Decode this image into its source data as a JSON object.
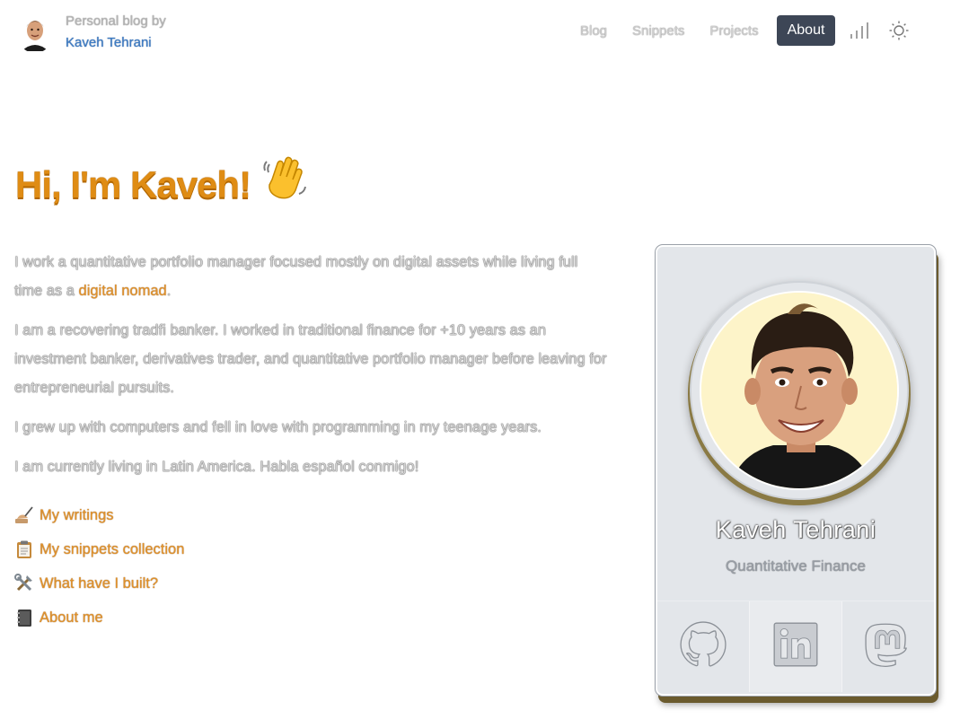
{
  "header": {
    "kicker": "Personal blog by",
    "author": "Kaveh Tehrani",
    "nav": {
      "blog": "Blog",
      "snippets": "Snippets",
      "projects": "Projects",
      "about": "About"
    },
    "icons": [
      "bar-chart-icon",
      "sun-icon"
    ]
  },
  "hero": {
    "greeting": "Hi, I'm Kaveh!",
    "emoji_icon": "waving-hand-icon"
  },
  "intro": {
    "p1_before": "I work a quantitative portfolio manager focused mostly on digital assets while living full time as a ",
    "p1_link": "digital nomad",
    "p1_after": ".",
    "p2": "I am a recovering tradfi banker. I worked in traditional finance for +10 years as an investment banker, derivatives trader, and quantitative portfolio manager before leaving for entrepreneurial pursuits.",
    "p3": "I grew up with computers and fell in love with programming in my teenage years.",
    "p4": "I am currently living in Latin America. Habla español conmigo!"
  },
  "quick_links": [
    {
      "icon": "writing-hand-icon",
      "label": "My writings"
    },
    {
      "icon": "clipboard-icon",
      "label": "My snippets collection"
    },
    {
      "icon": "tools-icon",
      "label": "What have I built?"
    },
    {
      "icon": "notebook-icon",
      "label": "About me"
    }
  ],
  "card": {
    "name": "Kaveh Tehrani",
    "title": "Quantitative Finance",
    "socials": [
      "github-icon",
      "linkedin-icon",
      "mastodon-icon"
    ]
  },
  "colors": {
    "accent": "#df8c14",
    "link": "#e2922a",
    "nav_active_bg": "#3d4656",
    "author_blue": "#3d7bc4",
    "card_bg": "#e3e6ea"
  }
}
